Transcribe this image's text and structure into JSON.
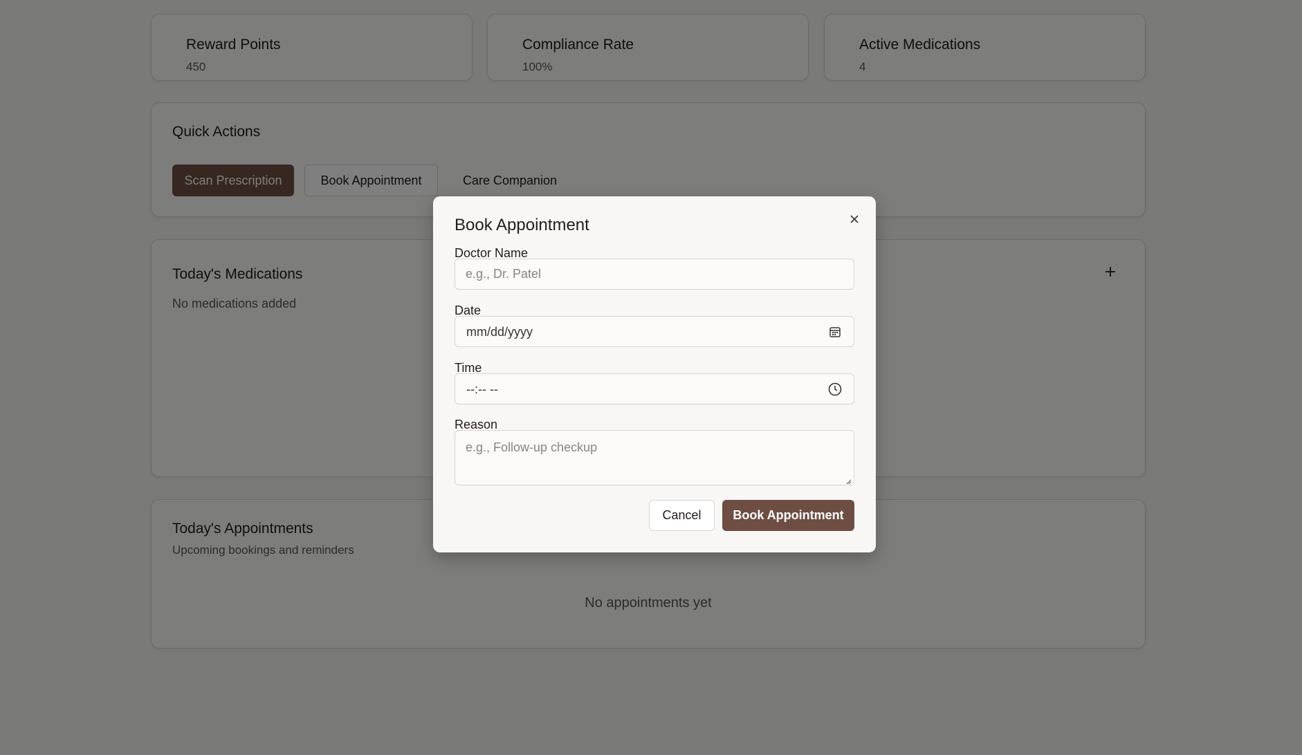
{
  "stats": [
    {
      "title": "Reward Points",
      "value": "450"
    },
    {
      "title": "Compliance Rate",
      "value": "100%"
    },
    {
      "title": "Active Medications",
      "value": "4"
    }
  ],
  "quick_actions": {
    "title": "Quick Actions",
    "scan_label": "Scan Prescription",
    "book_label": "Book Appointment",
    "companion_label": "Care Companion"
  },
  "medications": {
    "title": "Today's Medications",
    "empty": "No medications added",
    "add_icon": "plus-icon"
  },
  "appointments": {
    "title": "Today's Appointments",
    "subtitle": "Upcoming bookings and reminders",
    "empty": "No appointments yet"
  },
  "modal": {
    "title": "Book Appointment",
    "close_icon": "close-icon",
    "doctor_label": "Doctor Name",
    "doctor_placeholder": "e.g., Dr. Patel",
    "date_label": "Date",
    "date_value": "mm/dd/yyyy",
    "date_icon": "calendar-icon",
    "time_label": "Time",
    "time_value": "--:-- --",
    "time_icon": "clock-icon",
    "reason_label": "Reason",
    "reason_placeholder": "e.g., Follow-up checkup",
    "cancel_label": "Cancel",
    "submit_label": "Book Appointment"
  },
  "colors": {
    "primary": "#6e4e43",
    "overlay": "rgba(0,0,0,0.5)",
    "background": "#f5f4f2"
  }
}
